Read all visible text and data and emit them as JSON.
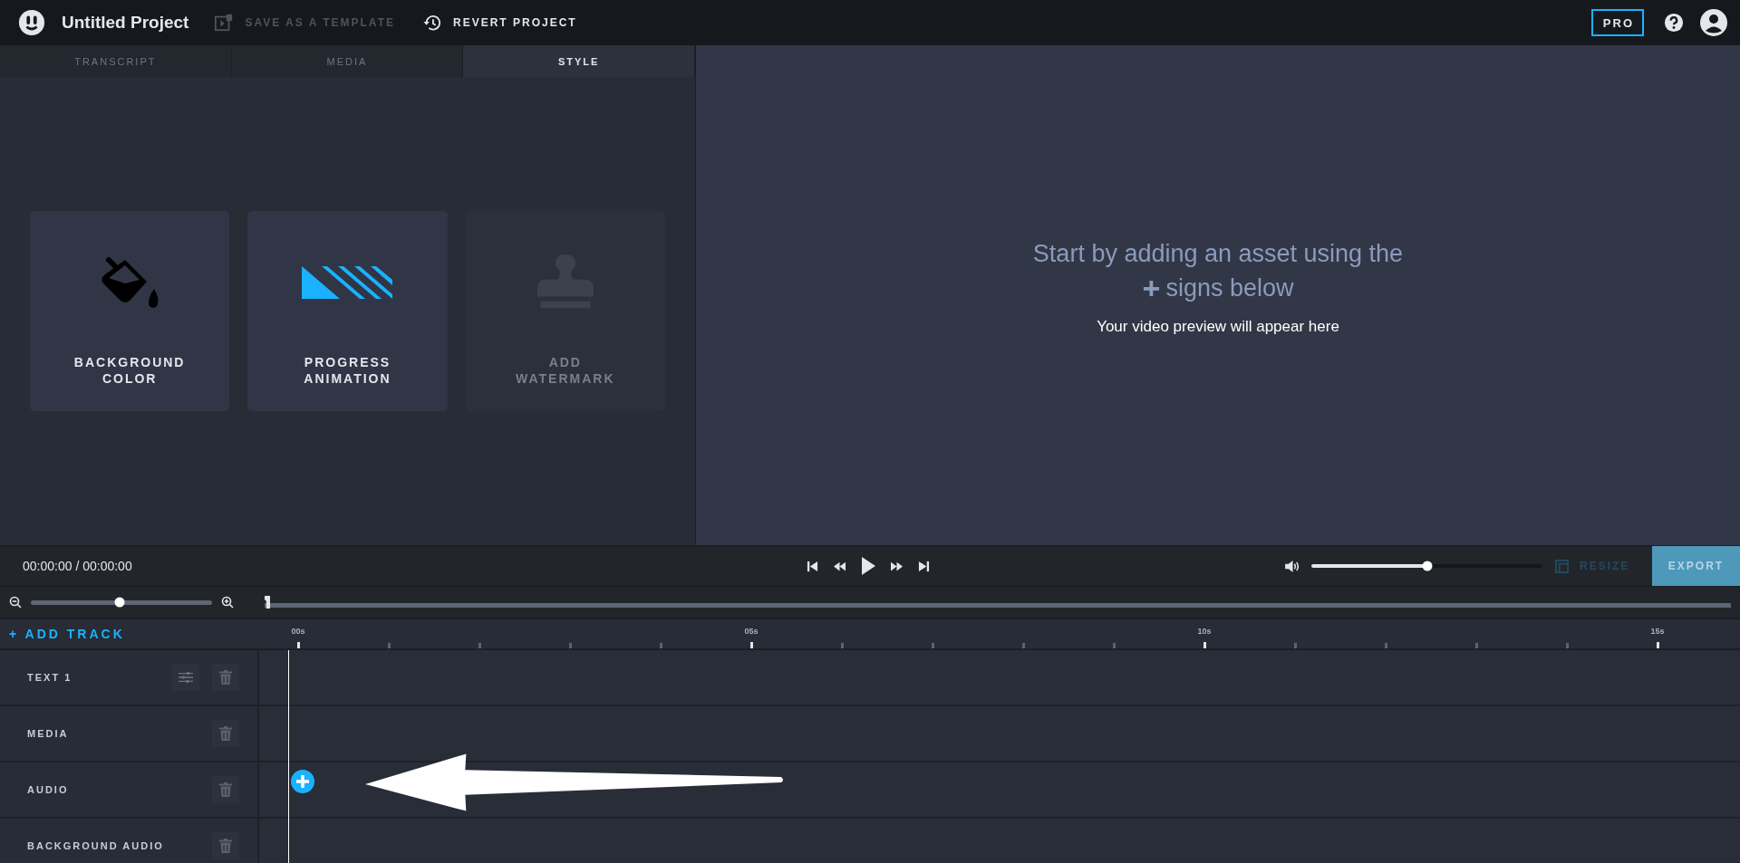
{
  "header": {
    "project_title": "Untitled Project",
    "save_template": {
      "label": "SAVE AS A TEMPLATE",
      "disabled": true
    },
    "revert": {
      "label": "REVERT PROJECT"
    },
    "pro_badge": "PRO"
  },
  "tabs": [
    {
      "label": "TRANSCRIPT",
      "selected": false
    },
    {
      "label": "MEDIA",
      "selected": false
    },
    {
      "label": "STYLE",
      "selected": true
    }
  ],
  "style_cards": [
    {
      "kind": "bucket",
      "label": "BACKGROUND COLOR",
      "disabled": false
    },
    {
      "kind": "progress",
      "label": "PROGRESS ANIMATION",
      "disabled": false
    },
    {
      "kind": "stamp",
      "label": "ADD WATERMARK",
      "disabled": true
    }
  ],
  "preview": {
    "headline_1": "Start by adding an asset using the",
    "headline_2": "signs below",
    "plus_sign": "+",
    "note": "Your video preview will appear here"
  },
  "player": {
    "time": "00:00:00 / 00:00:00",
    "volume": {
      "level": 0.5
    },
    "resize": {
      "label": "RESIZE",
      "disabled": true
    },
    "export": "EXPORT"
  },
  "zoom": {
    "level": 0.49
  },
  "scrubber": {
    "level": 0
  },
  "add_track": "+ ADD TRACK",
  "ruler": {
    "labels": [
      "00s",
      "05s",
      "10s",
      "15s"
    ]
  },
  "tracks": [
    {
      "name": "TEXT 1",
      "has_settings": true
    },
    {
      "name": "MEDIA",
      "has_settings": false
    },
    {
      "name": "AUDIO",
      "has_settings": false
    },
    {
      "name": "BACKGROUND AUDIO",
      "has_settings": false
    }
  ]
}
